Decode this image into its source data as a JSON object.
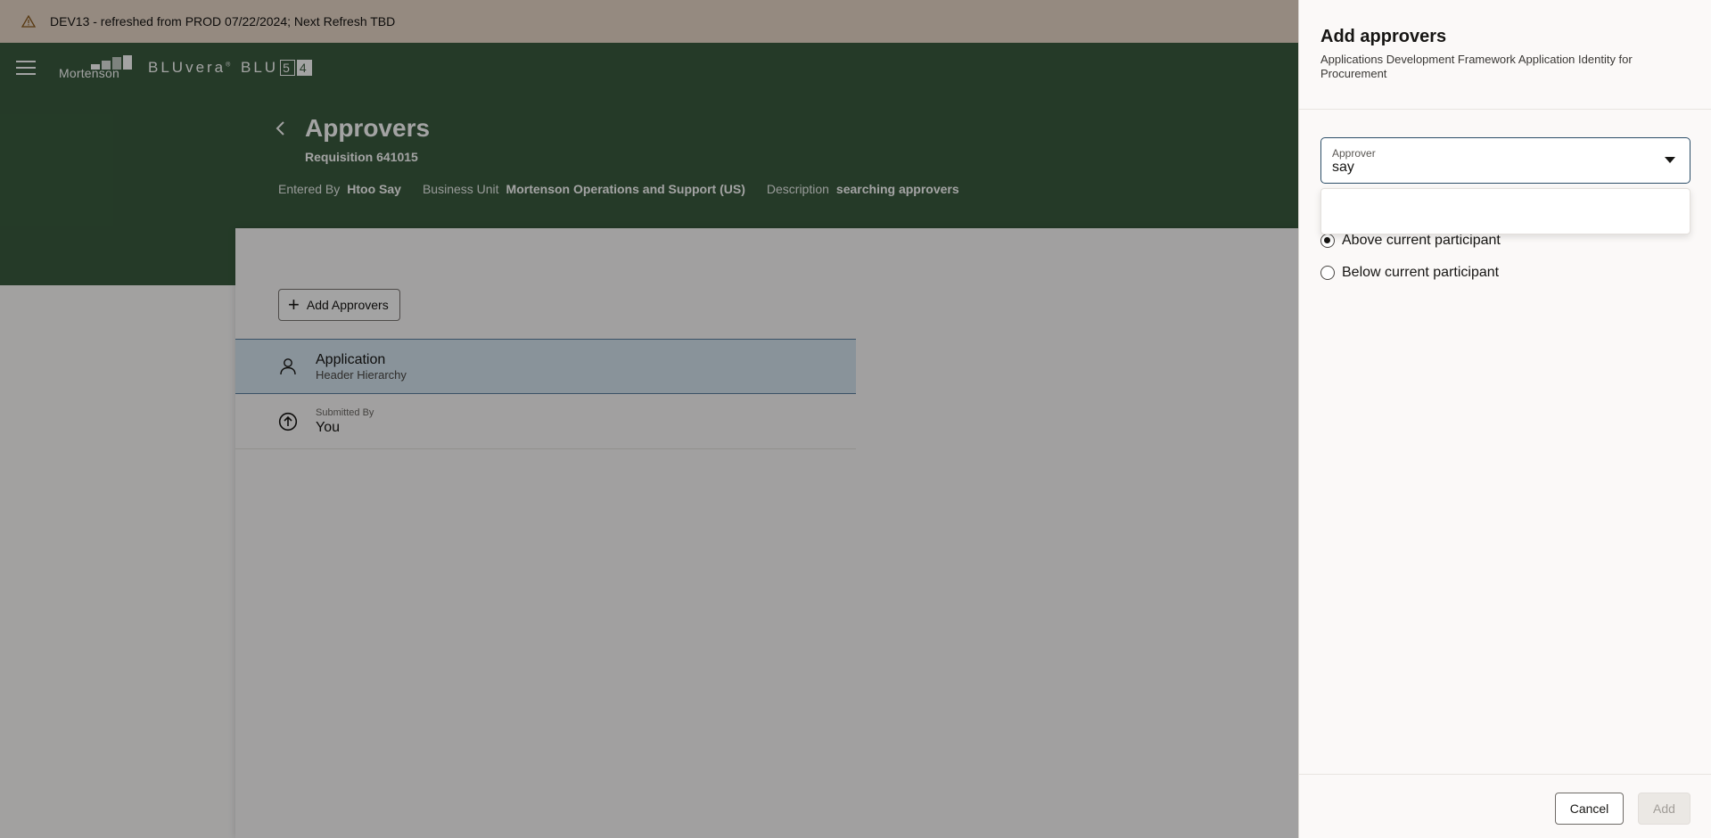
{
  "banner": {
    "text": "DEV13 - refreshed from PROD 07/22/2024; Next Refresh TBD"
  },
  "brand": {
    "logo1": "Mortenson",
    "logo2": "BLUvera",
    "logo2_mark": "®",
    "logo3_prefix": "BLU",
    "logo3_box1": "5",
    "logo3_box2": "4"
  },
  "header": {
    "title": "Approvers",
    "subtitle": "Requisition 641015",
    "meta": [
      {
        "label": "Entered By",
        "value": "Htoo Say"
      },
      {
        "label": "Business Unit",
        "value": "Mortenson Operations and Support (US)"
      },
      {
        "label": "Description",
        "value": "searching approvers"
      }
    ]
  },
  "content": {
    "add_button": "Add Approvers",
    "rows": [
      {
        "primary": "Application",
        "secondary": "Header Hierarchy"
      },
      {
        "label": "Submitted By",
        "primary": "You"
      }
    ]
  },
  "drawer": {
    "title": "Add approvers",
    "subtitle": "Applications Development Framework Application Identity for Procurement",
    "field_label": "Approver",
    "field_value": "say",
    "radios": [
      {
        "label": "Above current participant",
        "checked": true
      },
      {
        "label": "Below current participant",
        "checked": false
      }
    ],
    "cancel": "Cancel",
    "add": "Add"
  },
  "colors": {
    "header_bg": "#3a5c3f",
    "banner_bg": "#ead8c9",
    "selected_row": "#d6e6f1",
    "field_border": "#2c4e68"
  }
}
